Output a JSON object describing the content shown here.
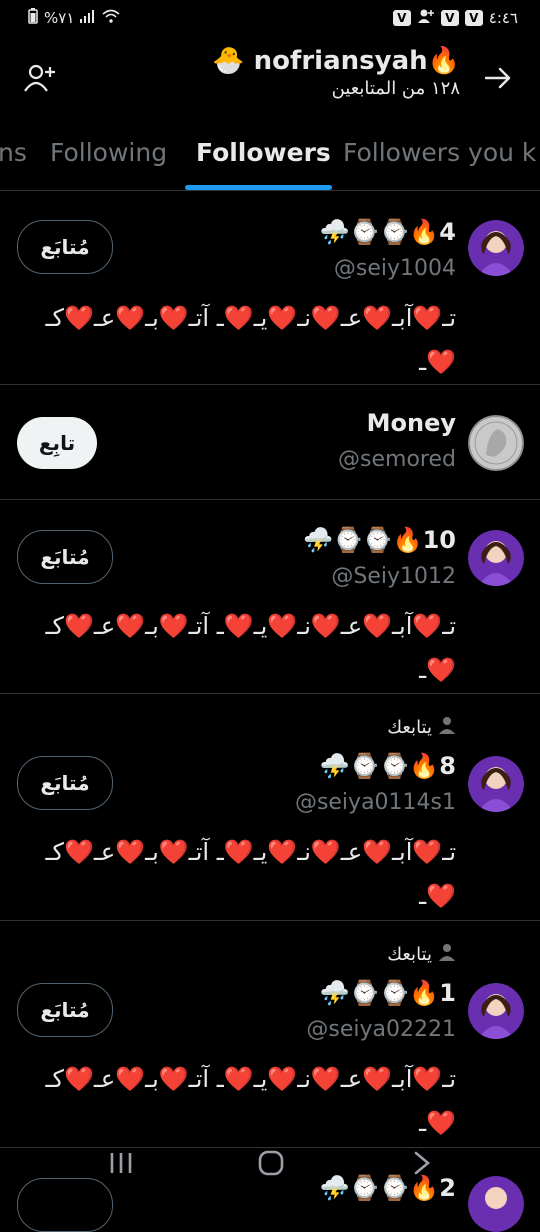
{
  "status": {
    "battery": "%٧١",
    "time": "٤:٤٦"
  },
  "header": {
    "title": "🐣 nofriansyah🔥",
    "subtitle": "١٢٨ من المتابعين"
  },
  "tabs": [
    {
      "label": "ns"
    },
    {
      "label": "Following"
    },
    {
      "label": "Followers"
    },
    {
      "label": "Followers you k"
    }
  ],
  "rows": [
    {
      "name": "⛈️⌚⌚🔥4",
      "handle": "@seiy1004",
      "bio": "تـ❤️آبـ❤️عـ❤️نـ❤️يـ❤️ـ آتـ❤️بـ❤️عـ❤️كـ❤️ـ",
      "button": "مُتابَع",
      "follows_you": ""
    },
    {
      "name": "Money",
      "handle": "@semored",
      "bio": "",
      "button": "تابِع",
      "follows_you": ""
    },
    {
      "name": "⛈️⌚⌚🔥10",
      "handle": "@Seiy1012",
      "bio": "تـ❤️آبـ❤️عـ❤️نـ❤️يـ❤️ـ آتـ❤️بـ❤️عـ❤️كـ❤️ـ",
      "button": "مُتابَع",
      "follows_you": ""
    },
    {
      "name": "⛈️⌚⌚🔥8",
      "handle": "@seiya0114s1",
      "bio": "تـ❤️آبـ❤️عـ❤️نـ❤️يـ❤️ـ آتـ❤️بـ❤️عـ❤️كـ❤️ـ",
      "button": "مُتابَع",
      "follows_you": "يتابعك"
    },
    {
      "name": "⛈️⌚⌚🔥1",
      "handle": "@seiya02221",
      "bio": "تـ❤️آبـ❤️عـ❤️نـ❤️يـ❤️ـ آتـ❤️بـ❤️عـ❤️كـ❤️ـ",
      "button": "مُتابَع",
      "follows_you": "يتابعك"
    },
    {
      "name": "⛈️⌚⌚🔥2",
      "handle": "",
      "bio": "",
      "button": "",
      "follows_you": ""
    }
  ],
  "colors": {
    "accent": "#1d9bf0",
    "background": "#000000",
    "text": "#e7e9ea",
    "muted": "#71767b",
    "divider": "#2f3336"
  },
  "icons": {
    "back": "arrow-right-icon",
    "add_user": "add-user-icon",
    "nav": [
      "recents-icon",
      "home-icon",
      "back-chevron-icon"
    ]
  }
}
